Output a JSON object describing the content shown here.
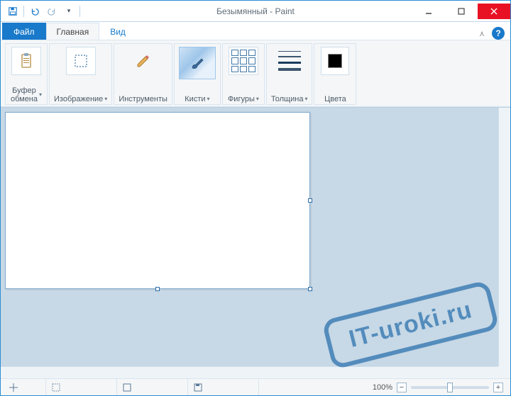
{
  "window": {
    "title": "Безымянный - Paint"
  },
  "tabs": {
    "file": "Файл",
    "home": "Главная",
    "view": "Вид"
  },
  "ribbon": {
    "clipboard": "Буфер\nобмена",
    "image": "Изображение",
    "tools": "Инструменты",
    "brushes": "Кисти",
    "shapes": "Фигуры",
    "size": "Толщина",
    "colors": "Цвета"
  },
  "status": {
    "zoom_label": "100%"
  },
  "watermark": "IT-uroki.ru"
}
